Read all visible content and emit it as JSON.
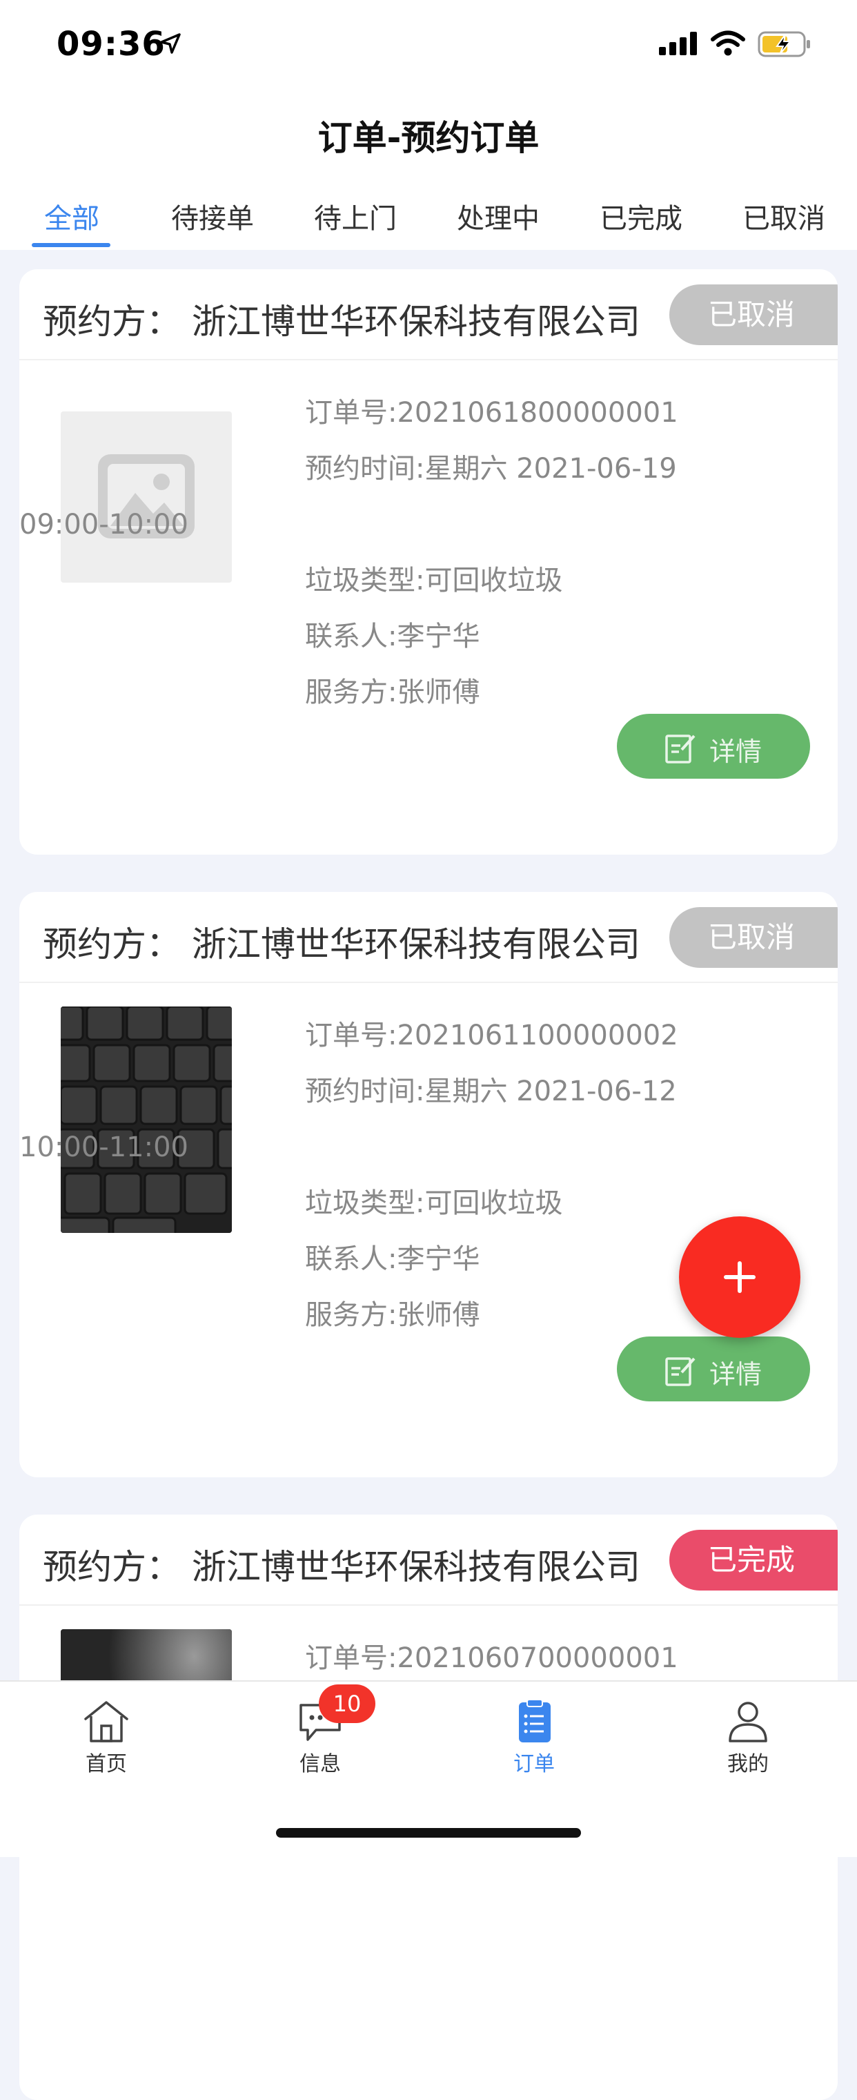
{
  "status_bar": {
    "time": "09:36"
  },
  "header": {
    "title": "订单-预约订单"
  },
  "tabs": [
    {
      "label": "全部",
      "active": true
    },
    {
      "label": "待接单",
      "active": false
    },
    {
      "label": "待上门",
      "active": false
    },
    {
      "label": "处理中",
      "active": false
    },
    {
      "label": "已完成",
      "active": false
    },
    {
      "label": "已取消",
      "active": false
    }
  ],
  "orders": [
    {
      "party": "预约方：  浙江博世华环保科技有限公司",
      "status": "已取消",
      "status_color": "#c3c3c3",
      "order_no": "订单号:2021061800000001",
      "time_line1": "预约时间:星期六 2021-06-19",
      "time_line2": "09:00-10:00",
      "waste_type": "垃圾类型:可回收垃圾",
      "contact": "联系人:李宁华",
      "provider": "服务方:张师傅",
      "detail_label": "详情",
      "image": "placeholder-image"
    },
    {
      "party": "预约方：  浙江博世华环保科技有限公司",
      "status": "已取消",
      "status_color": "#c3c3c3",
      "order_no": "订单号:2021061100000002",
      "time_line1": "预约时间:星期六 2021-06-12",
      "time_line2": "10:00-11:00",
      "waste_type": "垃圾类型:可回收垃圾",
      "contact": "联系人:李宁华",
      "provider": "服务方:张师傅",
      "detail_label": "详情",
      "image": "keyboard-photo"
    },
    {
      "party": "预约方：  浙江博世华环保科技有限公司",
      "status": "已完成",
      "status_color": "#ea4c6a",
      "order_no": "订单号:2021060700000001",
      "image": "dark-photo"
    }
  ],
  "bottom_nav": [
    {
      "label": "首页",
      "icon": "home-icon",
      "active": false
    },
    {
      "label": "信息",
      "icon": "message-icon",
      "active": false,
      "badge": "10"
    },
    {
      "label": "订单",
      "icon": "order-clipboard-icon",
      "active": true
    },
    {
      "label": "我的",
      "icon": "user-icon",
      "active": false
    }
  ],
  "colors": {
    "accent": "#3b86ee",
    "detail_button": "#66b86b",
    "fab": "#f92b22"
  }
}
